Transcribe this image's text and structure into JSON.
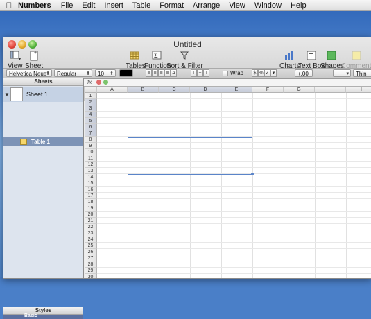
{
  "menubar": {
    "app": "Numbers",
    "items": [
      "File",
      "Edit",
      "Insert",
      "Table",
      "Format",
      "Arrange",
      "View",
      "Window",
      "Help"
    ]
  },
  "window": {
    "title": "Untitled"
  },
  "toolbar": {
    "view": "View",
    "sheet": "Sheet",
    "tables": "Tables",
    "function": "Function",
    "sort_filter": "Sort & Filter",
    "charts": "Charts",
    "textbox": "Text Box",
    "shapes": "Shapes",
    "comment": "Comment"
  },
  "formatbar": {
    "font": "Helvetica Neue",
    "style": "Regular",
    "size": "10",
    "wrap": "Wrap",
    "decimals": "+.00",
    "line": "Thin"
  },
  "formulabar": {
    "fx": "fx"
  },
  "sidebar": {
    "sheets_header": "Sheets",
    "sheet_name": "Sheet 1",
    "table_name": "Table 1",
    "styles_header": "Styles",
    "style_item": "Basic"
  },
  "grid": {
    "columns": [
      "A",
      "B",
      "C",
      "D",
      "E",
      "F",
      "G",
      "H",
      "I"
    ],
    "rows": [
      "1",
      "2",
      "3",
      "4",
      "5",
      "6",
      "7",
      "8",
      "9",
      "10",
      "11",
      "12",
      "13",
      "14",
      "15",
      "16",
      "17",
      "18",
      "19",
      "20",
      "21",
      "22",
      "23",
      "24",
      "25",
      "26",
      "27",
      "28",
      "29",
      "30"
    ]
  }
}
